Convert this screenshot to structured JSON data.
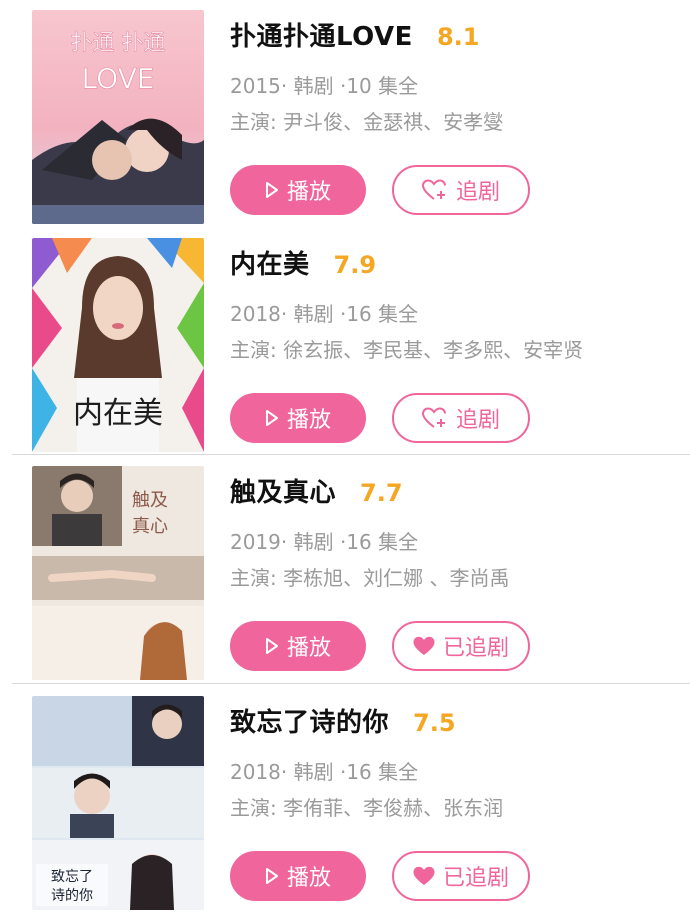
{
  "colors": {
    "accent": "#f0659b",
    "rating": "#f5a623",
    "meta_text": "#9a9a9a"
  },
  "items": [
    {
      "title": "扑通扑通LOVE",
      "rating": "8.1",
      "meta": "2015· 韩剧 ·10 集全",
      "cast": "主演: 尹斗俊、金瑟祺、安孝燮",
      "play_label": "播放",
      "follow_label": "追剧",
      "followed": false,
      "poster_text": [
        "扑通 扑通",
        "LOVE"
      ]
    },
    {
      "title": "内在美",
      "rating": "7.9",
      "meta": "2018· 韩剧 ·16 集全",
      "cast": "主演: 徐玄振、李民基、李多熙、安宰贤",
      "play_label": "播放",
      "follow_label": "追剧",
      "followed": false,
      "poster_text": [
        "内在美"
      ]
    },
    {
      "title": "触及真心",
      "rating": "7.7",
      "meta": "2019· 韩剧 ·16 集全",
      "cast": "主演: 李栋旭、刘仁娜 、李尚禹",
      "play_label": "播放",
      "follow_label": "已追剧",
      "followed": true,
      "poster_text": [
        "触及",
        "真心"
      ]
    },
    {
      "title": "致忘了诗的你",
      "rating": "7.5",
      "meta": "2018· 韩剧 ·16 集全",
      "cast": "主演: 李侑菲、李俊赫、张东润",
      "play_label": "播放",
      "follow_label": "已追剧",
      "followed": true,
      "poster_text": [
        "致忘了",
        "诗的你"
      ]
    }
  ]
}
